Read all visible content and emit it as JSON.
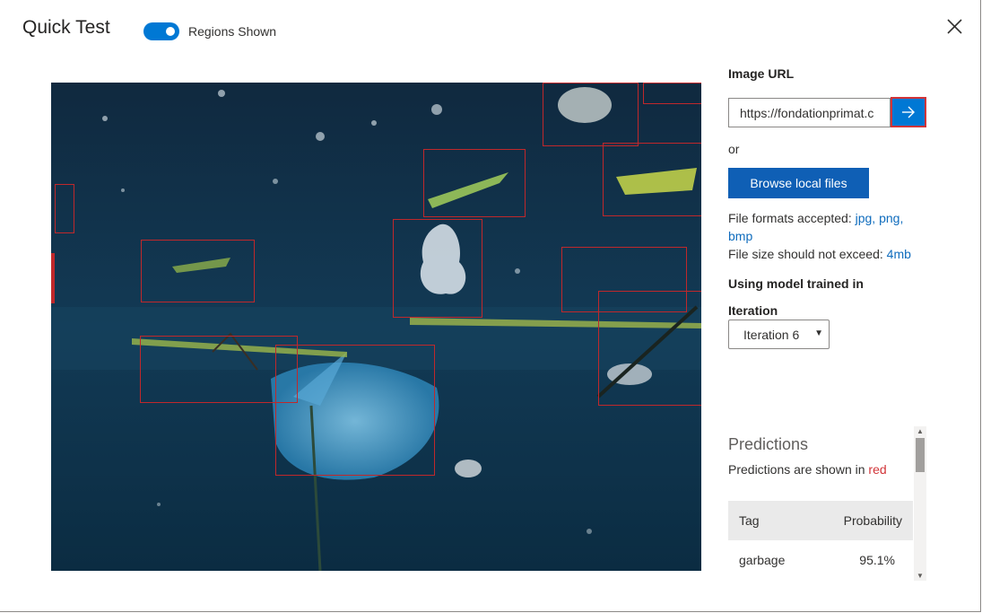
{
  "dialog": {
    "title": "Quick Test",
    "toggle_label": "Regions Shown",
    "toggle_on": true,
    "close_icon": "close-icon"
  },
  "image": {
    "description_icon": "underwater-garbage-image",
    "region_color": "#c0282b"
  },
  "panel": {
    "image_url_label": "Image URL",
    "url_value": "https://fondationprimat.c",
    "go_icon": "arrow-right-icon",
    "or_text": "or",
    "browse_label": "Browse local files",
    "formats_prefix": "File formats accepted:",
    "format_jpg": "jpg,",
    "format_png": "png,",
    "format_bmp": "bmp",
    "size_prefix": "File size should not exceed:",
    "size_value": "4mb",
    "model_label": "Using model trained in",
    "iteration_label": "Iteration",
    "iteration_value": "Iteration 6"
  },
  "predictions": {
    "title": "Predictions",
    "subtitle_prefix": "Predictions are shown in",
    "subtitle_color_word": "red",
    "columns": [
      "Tag",
      "Probability"
    ],
    "rows": [
      {
        "tag": "garbage",
        "probability": "95.1%"
      }
    ]
  },
  "colors": {
    "accent": "#0078d4",
    "browse_button": "#0f5fb5",
    "prediction_red": "#d13438"
  }
}
